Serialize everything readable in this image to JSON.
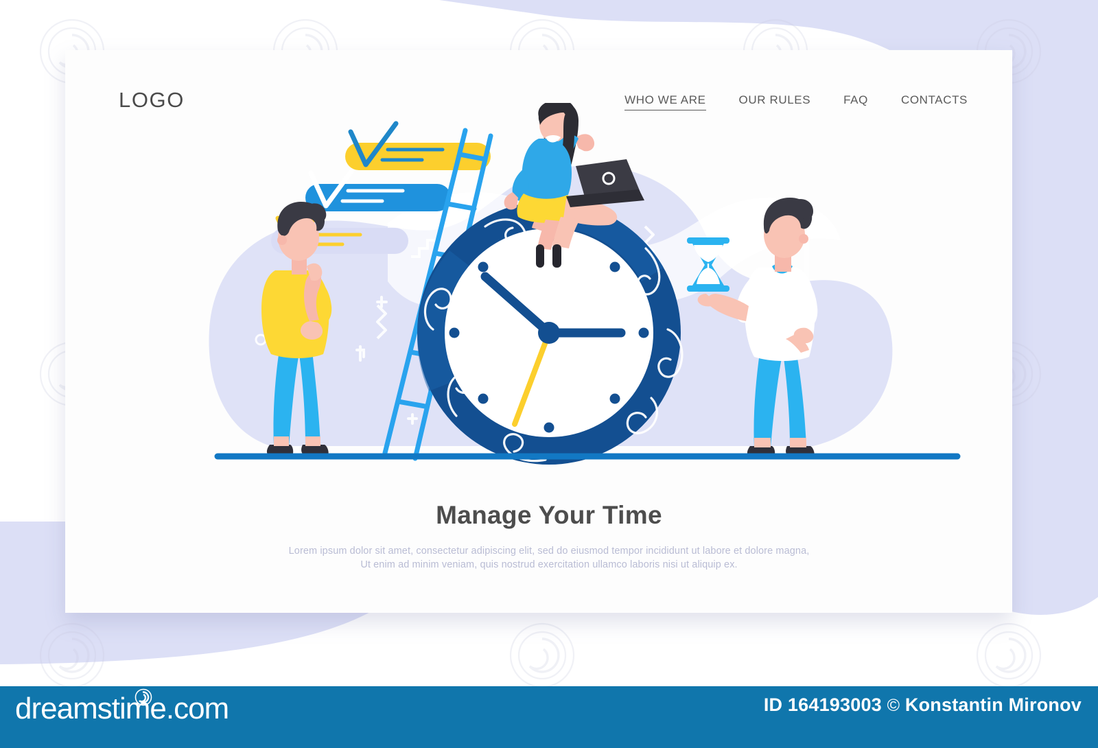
{
  "header": {
    "logo": "LOGO",
    "nav": [
      {
        "label": "WHO WE ARE",
        "active": true
      },
      {
        "label": "OUR RULES",
        "active": false
      },
      {
        "label": "FAQ",
        "active": false
      },
      {
        "label": "CONTACTS",
        "active": false
      }
    ]
  },
  "hero": {
    "headline": "Manage Your Time",
    "body_line_1": "Lorem ipsum dolor sit amet, consectetur adipiscing elit, sed do eiusmod tempor incididunt ut labore et dolore magna,",
    "body_line_2": "Ut enim ad minim veniam, quis nostrud exercitation ullamco laboris nisi ut aliquip ex."
  },
  "illustration": {
    "clock": {
      "hour_hand_angle": -55,
      "minute_hand_angle": 90,
      "second_hand_angle": 200,
      "tick_count": 8
    },
    "checklist": [
      {
        "pill_color": "#fccf2d",
        "check_color": "#1f87c9",
        "line_color": "#1f87c9"
      },
      {
        "pill_color": "#1f92dd",
        "check_color": "#ffffff",
        "line_color": "#ffffff"
      },
      {
        "pill_color": "#d9dcf5",
        "check_color": "#fccf2d",
        "line_color": "#fccf2d"
      }
    ],
    "characters": [
      {
        "name": "thinking-man",
        "shirt": "#fdd834",
        "pants": "#2bb3f0",
        "hair": "#3a3a44",
        "shoes": "#30303a"
      },
      {
        "name": "woman-with-laptop",
        "top": "#2fa8e8",
        "skirt": "#fdd834",
        "hair": "#2c2c33",
        "laptop": "#3b3b44"
      },
      {
        "name": "man-with-hourglass",
        "shirt": "#ffffff",
        "pants": "#2bb3f0",
        "hair": "#3a3a44",
        "shoes": "#30303a"
      }
    ],
    "ladder_color": "#29a3ee",
    "ground_line_color": "#1278c4"
  },
  "colors": {
    "page_bg": "#ffffff",
    "blob_lavender": "#dcdff6",
    "card_bg": "#fdfdfd",
    "clock_ring": "#134f91",
    "clock_ring_light": "#1a63ab",
    "clock_face": "#ffffff",
    "accent_yellow": "#fccf2d",
    "accent_blue": "#1f92dd",
    "text_dark": "#4d4d4d",
    "text_muted": "#b9bcd4",
    "footer_bg": "#1076ac"
  },
  "footer": {
    "brand": "dreamstime.com",
    "id_label": "ID 164193003",
    "copyright_symbol": "©",
    "author": "Konstantin Mironov"
  }
}
